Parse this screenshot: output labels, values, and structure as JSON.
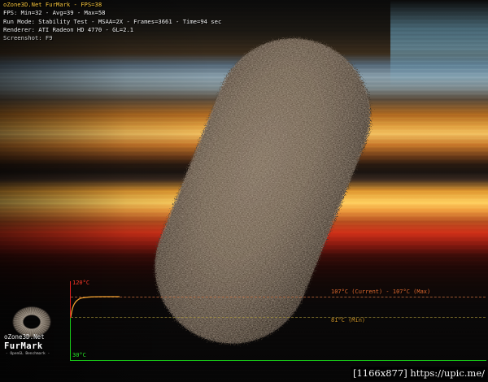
{
  "hud": {
    "title": "oZone3D.Net FurMark - FPS=38",
    "fps_line": "FPS: Min=32 - Avg=39 - Max=58",
    "run_line": "Run Mode: Stability Test - MSAA=2X - Frames=3661 - Time=94 sec",
    "renderer_line": "Renderer: ATI Radeon HD 4770 - GL=2.1",
    "screenshot_line": "Screenshot: F9"
  },
  "temperature_graph": {
    "max_scale_label": "120°C",
    "min_scale_label": "30°C",
    "current_label": "107°C (Current) - 107°C (Max)",
    "min_label": "81°C (Min)",
    "current_temp": 107,
    "max_temp": 107,
    "min_temp": 81,
    "scale_max": 120,
    "scale_min": 30,
    "colors": {
      "max_axis": "#e02020",
      "min_axis": "#18c818",
      "curve": "#f0a030"
    }
  },
  "logo": {
    "site": "oZone3D.Net",
    "name": "FurMark",
    "subtitle": "- OpenGL Benchmark -"
  },
  "watermark": {
    "text": "[1166x877] https://upic.me/"
  },
  "colors": {
    "title": "#f3c23a",
    "hud_text": "#f0f0f0"
  }
}
